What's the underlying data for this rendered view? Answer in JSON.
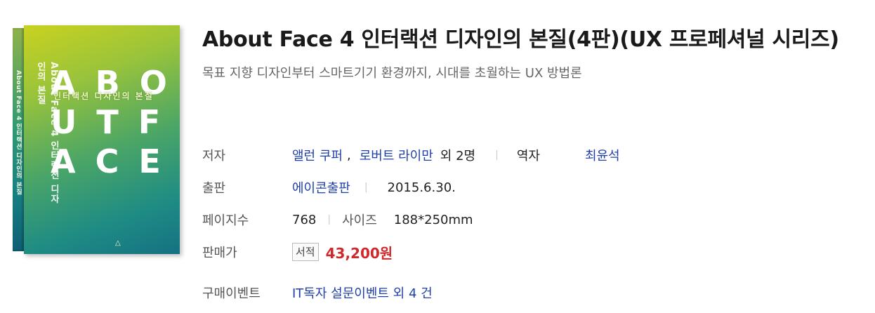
{
  "book": {
    "title": "About Face 4 인터랙션 디자인의 본질(4판)(UX 프로페셔널 시리즈)",
    "subtitle": "목표 지향 디자인부터 스마트기기 환경까지, 시대를 초월하는 UX 방법론"
  },
  "cover": {
    "letters": [
      "A B O",
      "U T F",
      "A C E"
    ],
    "subtitle_ko": "인터랙션 디자인의 본질",
    "side_title": "About Face 4 인터랙션 디자인의 본질",
    "colors": {
      "top": "#c9d21f",
      "bottom": "#157182"
    }
  },
  "details": {
    "author": {
      "label": "저자",
      "names": [
        "앨런 쿠퍼",
        "로버트 라이만"
      ],
      "extra": "외 2명"
    },
    "translator": {
      "label": "역자",
      "name": "최윤석"
    },
    "publisher": {
      "label": "출판",
      "name": "에이콘출판",
      "date": "2015.6.30."
    },
    "pages": {
      "label": "페이지수",
      "value": "768",
      "size_label": "사이즈",
      "size_value": "188*250mm"
    },
    "price": {
      "label": "판매가",
      "badge": "서적",
      "value": "43,200원"
    },
    "event": {
      "label": "구매이벤트",
      "value": "IT독자 설문이벤트 외 4 건"
    }
  },
  "colors": {
    "link": "#1f3fa8",
    "price": "#d0292b",
    "label": "#555555"
  }
}
